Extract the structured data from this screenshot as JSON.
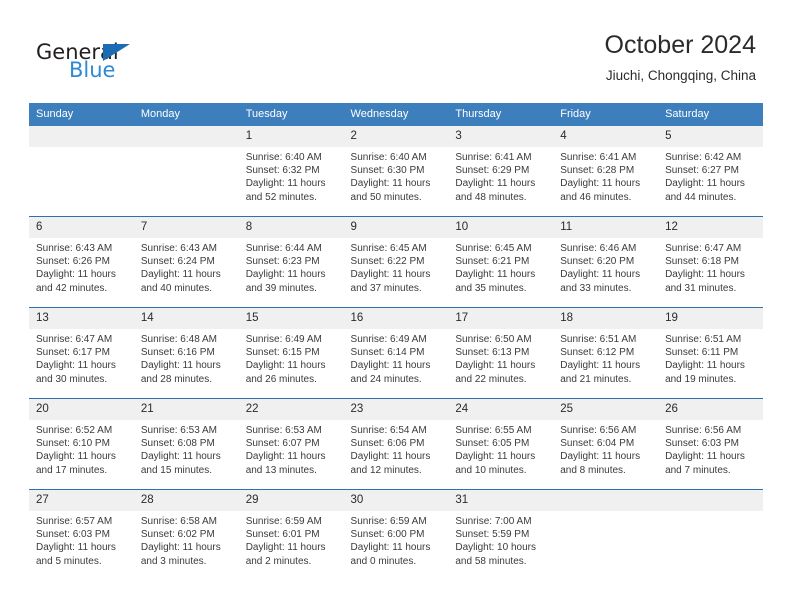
{
  "brand": {
    "name_part1": "General",
    "name_part2": "Blue",
    "triangle_color": "#1b6cb5",
    "blue_text_color": "#2e8ad4"
  },
  "header": {
    "title": "October 2024",
    "subtitle": "Jiuchi, Chongqing, China"
  },
  "theme": {
    "header_bg": "#3d7ebc",
    "row_divider": "#2f6fab",
    "daynum_bg": "#f0f0f0",
    "text": "#3b3b3b"
  },
  "weekdays": [
    "Sunday",
    "Monday",
    "Tuesday",
    "Wednesday",
    "Thursday",
    "Friday",
    "Saturday"
  ],
  "weeks": [
    [
      {
        "day": "",
        "sunrise": "",
        "sunset": "",
        "daylight": ""
      },
      {
        "day": "",
        "sunrise": "",
        "sunset": "",
        "daylight": ""
      },
      {
        "day": "1",
        "sunrise": "Sunrise: 6:40 AM",
        "sunset": "Sunset: 6:32 PM",
        "daylight": "Daylight: 11 hours and 52 minutes."
      },
      {
        "day": "2",
        "sunrise": "Sunrise: 6:40 AM",
        "sunset": "Sunset: 6:30 PM",
        "daylight": "Daylight: 11 hours and 50 minutes."
      },
      {
        "day": "3",
        "sunrise": "Sunrise: 6:41 AM",
        "sunset": "Sunset: 6:29 PM",
        "daylight": "Daylight: 11 hours and 48 minutes."
      },
      {
        "day": "4",
        "sunrise": "Sunrise: 6:41 AM",
        "sunset": "Sunset: 6:28 PM",
        "daylight": "Daylight: 11 hours and 46 minutes."
      },
      {
        "day": "5",
        "sunrise": "Sunrise: 6:42 AM",
        "sunset": "Sunset: 6:27 PM",
        "daylight": "Daylight: 11 hours and 44 minutes."
      }
    ],
    [
      {
        "day": "6",
        "sunrise": "Sunrise: 6:43 AM",
        "sunset": "Sunset: 6:26 PM",
        "daylight": "Daylight: 11 hours and 42 minutes."
      },
      {
        "day": "7",
        "sunrise": "Sunrise: 6:43 AM",
        "sunset": "Sunset: 6:24 PM",
        "daylight": "Daylight: 11 hours and 40 minutes."
      },
      {
        "day": "8",
        "sunrise": "Sunrise: 6:44 AM",
        "sunset": "Sunset: 6:23 PM",
        "daylight": "Daylight: 11 hours and 39 minutes."
      },
      {
        "day": "9",
        "sunrise": "Sunrise: 6:45 AM",
        "sunset": "Sunset: 6:22 PM",
        "daylight": "Daylight: 11 hours and 37 minutes."
      },
      {
        "day": "10",
        "sunrise": "Sunrise: 6:45 AM",
        "sunset": "Sunset: 6:21 PM",
        "daylight": "Daylight: 11 hours and 35 minutes."
      },
      {
        "day": "11",
        "sunrise": "Sunrise: 6:46 AM",
        "sunset": "Sunset: 6:20 PM",
        "daylight": "Daylight: 11 hours and 33 minutes."
      },
      {
        "day": "12",
        "sunrise": "Sunrise: 6:47 AM",
        "sunset": "Sunset: 6:18 PM",
        "daylight": "Daylight: 11 hours and 31 minutes."
      }
    ],
    [
      {
        "day": "13",
        "sunrise": "Sunrise: 6:47 AM",
        "sunset": "Sunset: 6:17 PM",
        "daylight": "Daylight: 11 hours and 30 minutes."
      },
      {
        "day": "14",
        "sunrise": "Sunrise: 6:48 AM",
        "sunset": "Sunset: 6:16 PM",
        "daylight": "Daylight: 11 hours and 28 minutes."
      },
      {
        "day": "15",
        "sunrise": "Sunrise: 6:49 AM",
        "sunset": "Sunset: 6:15 PM",
        "daylight": "Daylight: 11 hours and 26 minutes."
      },
      {
        "day": "16",
        "sunrise": "Sunrise: 6:49 AM",
        "sunset": "Sunset: 6:14 PM",
        "daylight": "Daylight: 11 hours and 24 minutes."
      },
      {
        "day": "17",
        "sunrise": "Sunrise: 6:50 AM",
        "sunset": "Sunset: 6:13 PM",
        "daylight": "Daylight: 11 hours and 22 minutes."
      },
      {
        "day": "18",
        "sunrise": "Sunrise: 6:51 AM",
        "sunset": "Sunset: 6:12 PM",
        "daylight": "Daylight: 11 hours and 21 minutes."
      },
      {
        "day": "19",
        "sunrise": "Sunrise: 6:51 AM",
        "sunset": "Sunset: 6:11 PM",
        "daylight": "Daylight: 11 hours and 19 minutes."
      }
    ],
    [
      {
        "day": "20",
        "sunrise": "Sunrise: 6:52 AM",
        "sunset": "Sunset: 6:10 PM",
        "daylight": "Daylight: 11 hours and 17 minutes."
      },
      {
        "day": "21",
        "sunrise": "Sunrise: 6:53 AM",
        "sunset": "Sunset: 6:08 PM",
        "daylight": "Daylight: 11 hours and 15 minutes."
      },
      {
        "day": "22",
        "sunrise": "Sunrise: 6:53 AM",
        "sunset": "Sunset: 6:07 PM",
        "daylight": "Daylight: 11 hours and 13 minutes."
      },
      {
        "day": "23",
        "sunrise": "Sunrise: 6:54 AM",
        "sunset": "Sunset: 6:06 PM",
        "daylight": "Daylight: 11 hours and 12 minutes."
      },
      {
        "day": "24",
        "sunrise": "Sunrise: 6:55 AM",
        "sunset": "Sunset: 6:05 PM",
        "daylight": "Daylight: 11 hours and 10 minutes."
      },
      {
        "day": "25",
        "sunrise": "Sunrise: 6:56 AM",
        "sunset": "Sunset: 6:04 PM",
        "daylight": "Daylight: 11 hours and 8 minutes."
      },
      {
        "day": "26",
        "sunrise": "Sunrise: 6:56 AM",
        "sunset": "Sunset: 6:03 PM",
        "daylight": "Daylight: 11 hours and 7 minutes."
      }
    ],
    [
      {
        "day": "27",
        "sunrise": "Sunrise: 6:57 AM",
        "sunset": "Sunset: 6:03 PM",
        "daylight": "Daylight: 11 hours and 5 minutes."
      },
      {
        "day": "28",
        "sunrise": "Sunrise: 6:58 AM",
        "sunset": "Sunset: 6:02 PM",
        "daylight": "Daylight: 11 hours and 3 minutes."
      },
      {
        "day": "29",
        "sunrise": "Sunrise: 6:59 AM",
        "sunset": "Sunset: 6:01 PM",
        "daylight": "Daylight: 11 hours and 2 minutes."
      },
      {
        "day": "30",
        "sunrise": "Sunrise: 6:59 AM",
        "sunset": "Sunset: 6:00 PM",
        "daylight": "Daylight: 11 hours and 0 minutes."
      },
      {
        "day": "31",
        "sunrise": "Sunrise: 7:00 AM",
        "sunset": "Sunset: 5:59 PM",
        "daylight": "Daylight: 10 hours and 58 minutes."
      },
      {
        "day": "",
        "sunrise": "",
        "sunset": "",
        "daylight": ""
      },
      {
        "day": "",
        "sunrise": "",
        "sunset": "",
        "daylight": ""
      }
    ]
  ]
}
